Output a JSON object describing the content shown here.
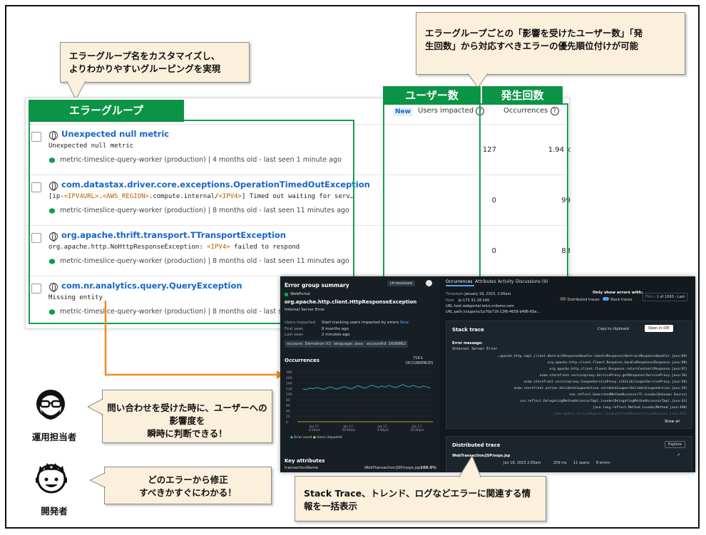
{
  "notes": {
    "top_left": [
      "エラーグループ名をカスタマイズし、",
      "よりわかりやすいグルーピングを実現"
    ],
    "top_right": [
      "エラーグループごとの「影響を受けたユーザー数」「発",
      "生回数」から対応すべきエラーの優先順位付けが可能"
    ],
    "ops": [
      "問い合わせを受けた時に、ユーザーへの",
      "影響度を",
      "瞬時に判断できる！"
    ],
    "dev": [
      "どのエラーから修正",
      "すべきかすぐにわかる！"
    ],
    "bottom": [
      "Stack Trace、トレンド、ログなどエラーに関連する情",
      "報を一括表示"
    ]
  },
  "headers": {
    "error_group": "エラーグループ",
    "users": "ユーザー数",
    "occurrences": "発生回数"
  },
  "columns": {
    "new_badge": "New",
    "users_impacted": "Users impacted",
    "occurrences": "Occurrences"
  },
  "errors": [
    {
      "title": "Unexpected null metric",
      "message": "Unexpected null metric",
      "meta": "metric-timeslice-query-worker (production)  |  4 months old - last seen 1 minute ago",
      "users": "127",
      "occurrences": "1.94 k"
    },
    {
      "title": "com.datastax.driver.core.exceptions.OperationTimedOutException",
      "message_parts": [
        "[ip-",
        "<IPV4URL>",
        ".",
        "<AWS_REGION>",
        ".compute.internal/",
        "<IPV4>",
        "] Timed out waiting for serv…"
      ],
      "meta": "metric-timeslice-query-worker (production)  |  8 months old - last seen 11 minutes ago",
      "users": "0",
      "occurrences": "99"
    },
    {
      "title": "org.apache.thrift.transport.TTransportException",
      "message_parts": [
        "org.apache.http.NoHttpResponseException: ",
        "<IPV4>",
        " failed to respond"
      ],
      "meta": "metric-timeslice-query-worker (production)  |  8 months old - last seen 11 minutes ago",
      "users": "0",
      "occurrences": "83"
    },
    {
      "title": "com.nr.analytics.query.QueryException",
      "message": "Missing entity",
      "meta": "metric-timeslice-query-worker (production)  |  8 months old - last seen 1 minute ago"
    }
  ],
  "figures": {
    "ops_label": "運用担当者",
    "dev_label": "開発者"
  },
  "detail": {
    "summary_title": "Error group summary",
    "status": "Unresolved",
    "app": "WebPortal",
    "exception": "org.apache.http.client.HttpResponseException",
    "exception_msg": "Internal Server Error",
    "users_impacted_label": "Users impacted",
    "users_impacted_value": "Start tracking users impacted by errors",
    "new": "New",
    "first_seen_label": "First seen",
    "first_seen": "9 months ago",
    "last_seen_label": "Last seen",
    "last_seen": "2 minutes ago",
    "chips": [
      "account: Demotron V2",
      "language: java",
      "accountId: 1606862"
    ],
    "occ_title": "Occurrences",
    "occ_total": "718 k",
    "occ_total_label": "OCCURRENCES",
    "y_ticks": [
      "180",
      "160",
      "140",
      "120",
      "100",
      "80",
      "60",
      "40",
      "20",
      "0"
    ],
    "x_ticks": [
      [
        "Jan 17,",
        "4:00am"
      ],
      [
        "Jan 17,",
        "10:00am"
      ],
      [
        "Jan 17,",
        "4:00pm"
      ],
      [
        "Jan 17,",
        "10:00pm"
      ]
    ],
    "legend": [
      "Error count",
      "Users impacted"
    ],
    "key_attr_title": "Key attributes",
    "key_attr_name": "transactionName",
    "key_attr_value": "WebTransaction/JSP/oops.jsp",
    "key_attr_pct": "100.0%",
    "tabs": [
      "Occurrences",
      "Attributes",
      "Activity",
      "Discussions (9)"
    ],
    "ts_label": "Timestam",
    "ts_value": "January 18, 2023, 2:06am",
    "host_label": "Host",
    "host_value": "ip-172-31-18-160",
    "url_host": "URL host  webportal.telco.nrdemo.com",
    "url_path": "URL path /coupons/1a70a716-13f6-4658-b486-60e…",
    "only_show": "Only show errors with:",
    "toggle1": "Distributed traces",
    "toggle2": "Stack traces",
    "pager_first": "First",
    "pager": "1 of 1000",
    "pager_last": "Last",
    "stack_title": "Stack trace",
    "copy": "Copy to clipboard",
    "open_ide": "Open in IDE",
    "err_msg_label": "Error message:",
    "err_msg": "Internal Server Error",
    "stack": [
      "…apache.http.impl.client.AbstractResponseHandler.handleResponse(AbstractResponseHandler.java:69)",
      "org.apache.http.client.fluent.Response.handleResponse(Response.java:90)",
      "org.apache.http.client.fluent.Response.returnContent(Response.java:97)",
      "acme.storefront.serviceproxy.ServiceProxy.getResponse(ServiceProxy.java:16)",
      "acme.storefront.serviceproxy.CouponServiceProxy.isValid(CouponServiceProxy.java:50)",
      "acme.storefront.action.ValidateCouponAction.validateCoupon(ValidateCouponAction.java:56)",
      "sun.reflect.GeneratedMethodAccessor75.invoke(Unknown Source)",
      "sun.reflect.DelegatingMethodAccessorImpl.invoke(DelegatingMethodAccessorImpl.java:43)",
      "java.lang.reflect.Method.invoke(Method.java:498)",
      "jodd.madvoc.ActionRequest.invokeActionMethod(ActionRequest.java:355)"
    ],
    "show_all": "Show all",
    "dt_title": "Distributed trace",
    "explore": "Explore",
    "dt_name": "WebTransaction/JSP/oops.jsp",
    "dt_row": [
      "Jan 18, 2023 2:05am",
      "259 ms",
      "11 spans",
      "8 errors"
    ]
  },
  "series": {
    "occurrences": [
      118,
      116,
      121,
      119,
      124,
      120,
      117,
      122,
      126,
      121,
      118,
      123,
      127,
      122,
      119,
      124,
      130,
      125,
      121,
      126,
      132,
      128,
      124,
      129,
      125,
      131,
      127,
      123,
      128,
      134,
      129,
      126,
      131,
      127,
      124,
      129,
      126,
      122
    ]
  }
}
